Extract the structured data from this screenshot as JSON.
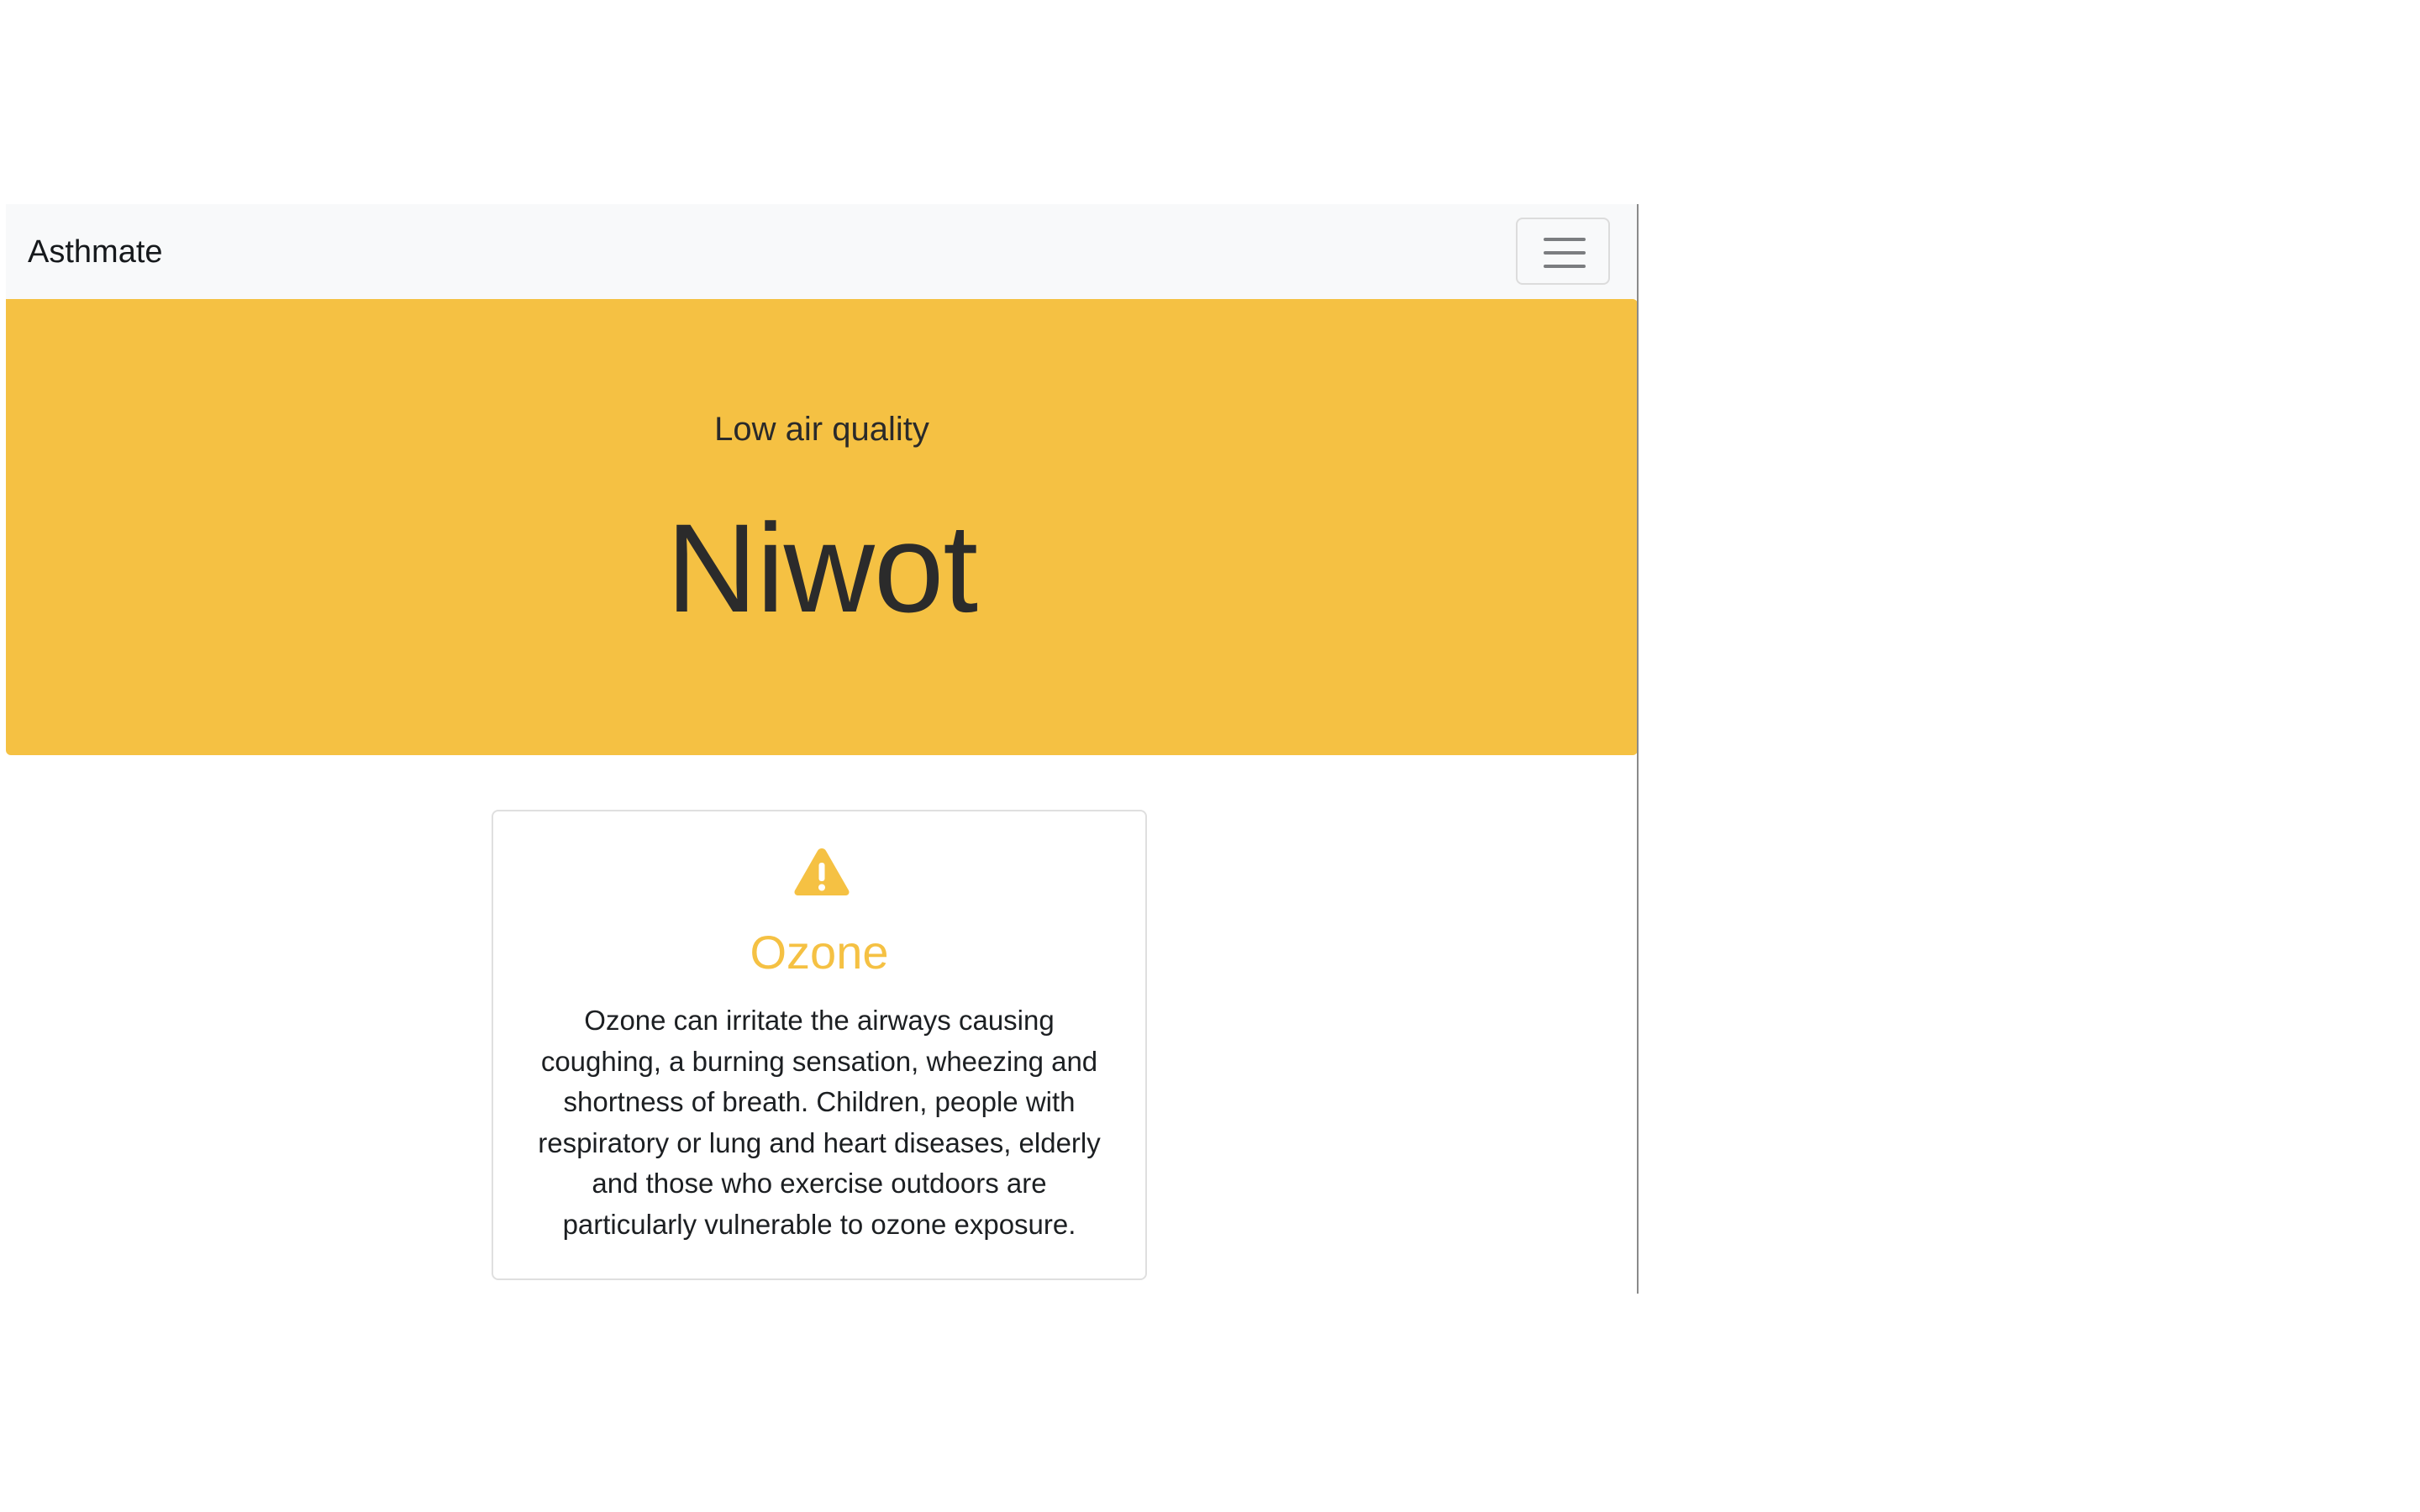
{
  "navbar": {
    "brand": "Asthmate",
    "toggler_icon": "hamburger-menu-icon"
  },
  "hero": {
    "subtitle": "Low air quality",
    "title": "Niwot",
    "background_color": "#f5c143"
  },
  "card": {
    "icon": "warning-triangle-icon",
    "title": "Ozone",
    "title_color": "#f5c143",
    "description": "Ozone can irritate the airways causing coughing, a burning sensation, wheezing and shortness of breath. Children, people with respiratory or lung and heart diseases, elderly and those who exercise outdoors are particularly vulnerable to ozone exposure."
  }
}
